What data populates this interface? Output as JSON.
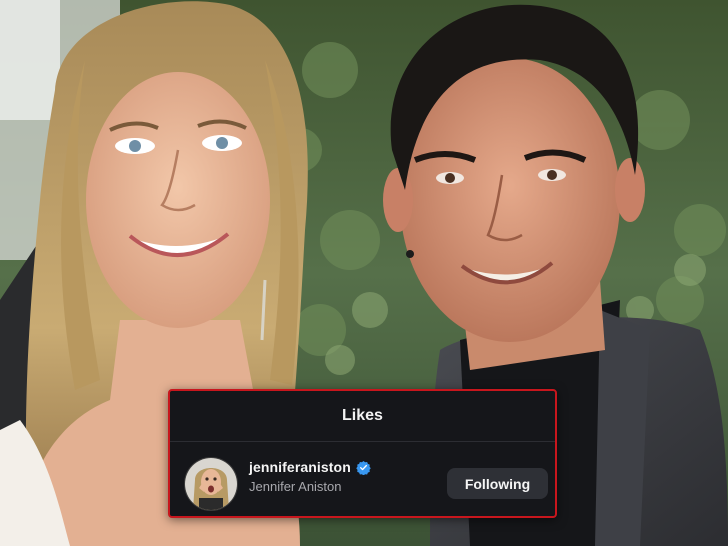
{
  "card": {
    "title": "Likes",
    "user": {
      "username": "jenniferaniston",
      "full_name": "Jennifer Aniston",
      "verified": true
    },
    "follow_button_label": "Following"
  },
  "colors": {
    "card_background": "#15161a",
    "card_border": "#c8161d",
    "button_background": "#2e3036",
    "verified_badge": "#3897f0"
  },
  "icons": [
    "verified-badge-icon"
  ]
}
